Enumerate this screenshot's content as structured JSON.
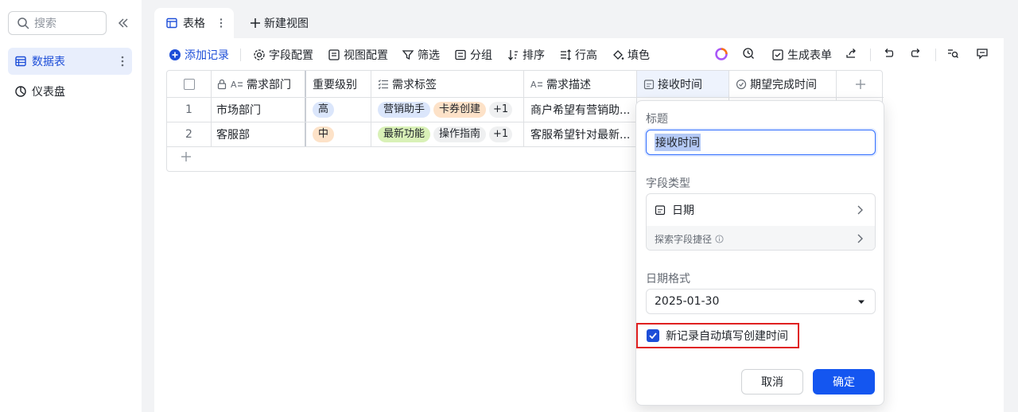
{
  "sidebar": {
    "search_placeholder": "搜索",
    "items": [
      {
        "label": "数据表",
        "icon": "table-icon",
        "active": true
      },
      {
        "label": "仪表盘",
        "icon": "dashboard-icon",
        "active": false
      }
    ]
  },
  "tabs": {
    "active_label": "表格",
    "new_view": "新建视图"
  },
  "toolbar": {
    "add_record": "添加记录",
    "field_config": "字段配置",
    "view_config": "视图配置",
    "filter": "筛选",
    "group": "分组",
    "sort": "排序",
    "row_height": "行高",
    "fill_color": "填色",
    "generate_form": "生成表单"
  },
  "table": {
    "columns": [
      "需求部门",
      "重要级别",
      "需求标签",
      "需求描述",
      "接收时间",
      "期望完成时间"
    ],
    "rows": [
      {
        "index": "1",
        "dept": "市场部门",
        "level": "高",
        "tags": [
          "营销助手",
          "卡券创建"
        ],
        "more": "+1",
        "desc": "商户希望有营销助..."
      },
      {
        "index": "2",
        "dept": "客服部",
        "level": "中",
        "tags": [
          "最新功能",
          "操作指南"
        ],
        "more": "+1",
        "desc": "客服希望针对最新..."
      }
    ]
  },
  "panel": {
    "title_label": "标题",
    "title_value": "接收时间",
    "field_type_label": "字段类型",
    "field_type_value": "日期",
    "explore_shortcut": "探索字段捷径",
    "date_format_label": "日期格式",
    "date_format_value": "2025-01-30",
    "auto_fill_label": "新记录自动填写创建时间",
    "auto_fill_checked": true,
    "cancel": "取消",
    "confirm": "确定"
  },
  "colors": {
    "accent": "#1456f0",
    "highlight_border": "#e02020",
    "tag_high_bg": "#dbe6fb",
    "tag_mid_bg": "#fde2c8"
  }
}
